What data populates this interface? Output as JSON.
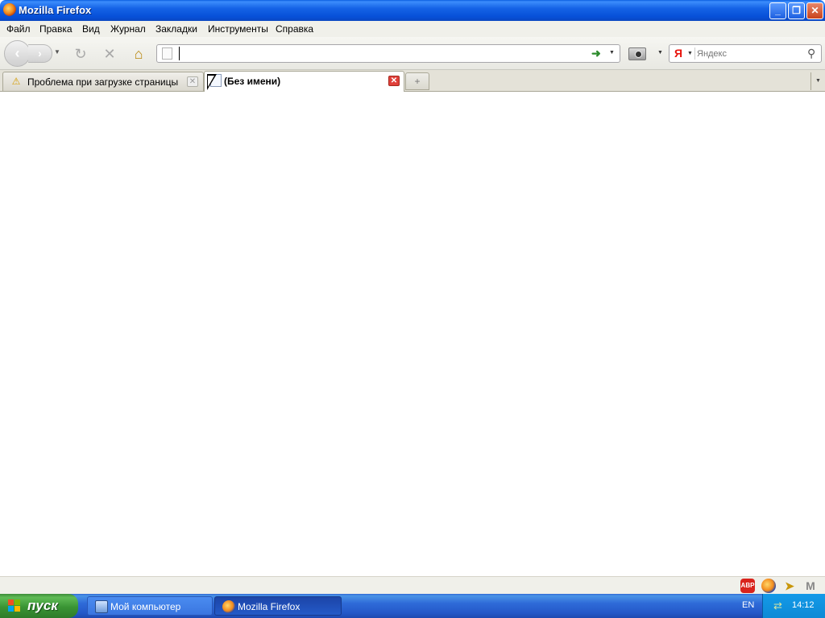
{
  "window": {
    "title": "Mozilla Firefox",
    "controls": {
      "minimize": "_",
      "maximize": "❐",
      "close": "✕"
    }
  },
  "menu": {
    "items": [
      "Файл",
      "Правка",
      "Вид",
      "Журнал",
      "Закладки",
      "Инструменты",
      "Справка"
    ]
  },
  "toolbar": {
    "url_value": "",
    "search_placeholder": "Яндекс",
    "search_engine_logo": "Я"
  },
  "tabs": [
    {
      "label": "Проблема при загрузке страницы",
      "icon": "warning-icon",
      "active": false
    },
    {
      "label": "(Без имени)",
      "icon": "blank-page-icon",
      "active": true
    }
  ],
  "statusbar": {
    "icons": [
      "adblock-plus-icon",
      "firefox-icon",
      "pointer-icon",
      "gmail-icon"
    ],
    "abp_text": "ABP"
  },
  "taskbar": {
    "start_label": "пуск",
    "tasks": [
      {
        "label": "Мой компьютер",
        "active": false
      },
      {
        "label": "Mozilla Firefox",
        "active": true
      }
    ],
    "language": "EN",
    "time": "14:12"
  },
  "colors": {
    "titlebar": "#0750d8",
    "taskbar": "#2e6ad8",
    "start_green": "#3a9434",
    "tab_close_red": "#e0403a"
  }
}
